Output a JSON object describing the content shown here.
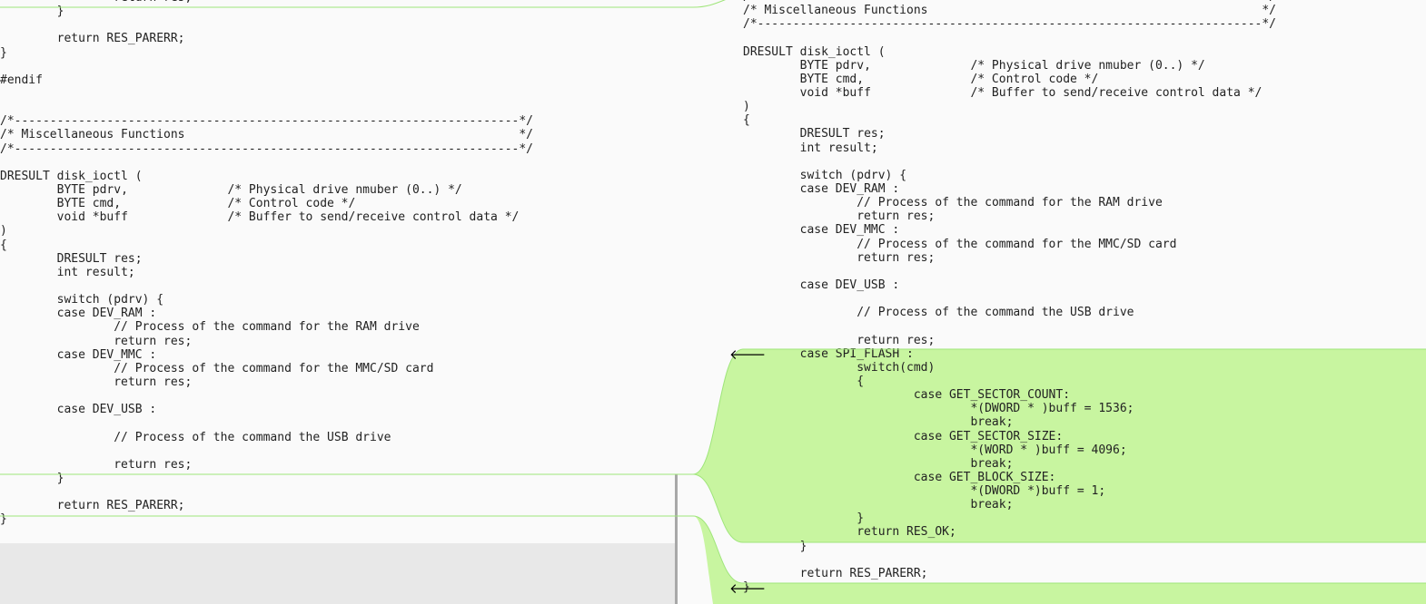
{
  "colors": {
    "added_fill": "#c8f5a0",
    "connector_stroke": "#9fe57a",
    "separator": "#a8a8a8",
    "code_text": "#222222"
  },
  "icons": {
    "merge_arrow": "left-arrow-icon",
    "merge_arrow_glyph": "🡐"
  },
  "left_lines": [
    "\t\treturn res;",
    "\t}",
    "",
    "\treturn RES_PARERR;",
    "}",
    "",
    "#endif",
    "",
    "",
    "/*-----------------------------------------------------------------------*/",
    "/* Miscellaneous Functions                                               */",
    "/*-----------------------------------------------------------------------*/",
    "",
    "DRESULT disk_ioctl (",
    "\tBYTE pdrv,\t\t/* Physical drive nmuber (0..) */",
    "\tBYTE cmd,\t\t/* Control code */",
    "\tvoid *buff\t\t/* Buffer to send/receive control data */",
    ")",
    "{",
    "\tDRESULT res;",
    "\tint result;",
    "",
    "\tswitch (pdrv) {",
    "\tcase DEV_RAM :",
    "\t\t// Process of the command for the RAM drive",
    "\t\treturn res;",
    "\tcase DEV_MMC :",
    "\t\t// Process of the command for the MMC/SD card",
    "\t\treturn res;",
    "",
    "\tcase DEV_USB :",
    "",
    "\t\t// Process of the command the USB drive",
    "",
    "\t\treturn res;",
    "\t}",
    "",
    "\treturn RES_PARERR;",
    "}"
  ],
  "right_lines": [
    "/*-----------------------------------------------------------------------*/",
    "/* Miscellaneous Functions                                               */",
    "/*-----------------------------------------------------------------------*/",
    "",
    "DRESULT disk_ioctl (",
    "\tBYTE pdrv,\t\t/* Physical drive nmuber (0..) */",
    "\tBYTE cmd,\t\t/* Control code */",
    "\tvoid *buff\t\t/* Buffer to send/receive control data */",
    ")",
    "{",
    "\tDRESULT res;",
    "\tint result;",
    "",
    "\tswitch (pdrv) {",
    "\tcase DEV_RAM :",
    "\t\t// Process of the command for the RAM drive",
    "\t\treturn res;",
    "\tcase DEV_MMC :",
    "\t\t// Process of the command for the MMC/SD card",
    "\t\treturn res;",
    "",
    "\tcase DEV_USB :",
    "",
    "\t\t// Process of the command the USB drive",
    "",
    "\t\treturn res;",
    "\tcase SPI_FLASH :",
    "\t\tswitch(cmd)",
    "\t\t{",
    "\t\t\tcase GET_SECTOR_COUNT:",
    "\t\t\t\t*(DWORD * )buff = 1536;",
    "\t\t\t\tbreak;",
    "\t\t\tcase GET_SECTOR_SIZE:",
    "\t\t\t\t*(WORD * )buff = 4096;",
    "\t\t\t\tbreak;",
    "\t\t\tcase GET_BLOCK_SIZE:",
    "\t\t\t\t*(DWORD *)buff = 1;",
    "\t\t\t\tbreak;",
    "\t\t}",
    "\t\treturn RES_OK;",
    "\t}",
    "",
    "\treturn RES_PARERR;",
    "}"
  ]
}
